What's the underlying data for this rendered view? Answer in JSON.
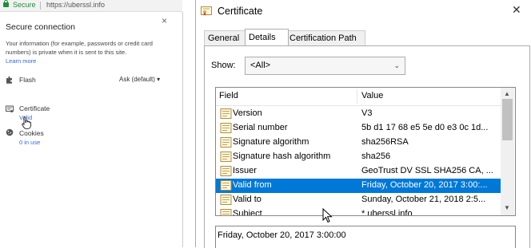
{
  "browser": {
    "secure_label": "Secure",
    "url": "https://uberssl.info"
  },
  "site_info": {
    "title": "Secure connection",
    "description": "Your information (for example, passwords or credit card numbers) is private when it is sent to this site.",
    "learn_more": "Learn more",
    "flash_label": "Flash",
    "flash_setting": "Ask (default)",
    "certificate_label": "Certificate",
    "certificate_status": "Valid",
    "cookies_label": "Cookies",
    "cookies_status": "0 in use",
    "close_glyph": "×",
    "dropdown_glyph": "▾"
  },
  "dialog": {
    "title": "Certificate",
    "close_glyph": "✕",
    "tabs": [
      "General",
      "Details",
      "Certification Path"
    ],
    "active_tab": "Details",
    "show_label": "Show:",
    "show_value": "<All>",
    "show_chevron": "⌄",
    "columns": {
      "field": "Field",
      "value": "Value"
    },
    "rows": [
      {
        "field": "Version",
        "value": "V3"
      },
      {
        "field": "Serial number",
        "value": "5b d1 17 68 e5 5e d0 e3 0c 1d..."
      },
      {
        "field": "Signature algorithm",
        "value": "sha256RSA"
      },
      {
        "field": "Signature hash algorithm",
        "value": "sha256"
      },
      {
        "field": "Issuer",
        "value": "GeoTrust DV SSL SHA256 CA, ..."
      },
      {
        "field": "Valid from",
        "value": "Friday, October 20, 2017 3:00:..."
      },
      {
        "field": "Valid to",
        "value": "Sunday, October 21, 2018 2:5..."
      },
      {
        "field": "Subject",
        "value": "* uberssl.info"
      }
    ],
    "selected_row": "Valid from",
    "scroll_up": "▲",
    "scroll_down": "▼",
    "detail_text": "Friday, October 20, 2017 3:00:00"
  },
  "colors": {
    "secure_green": "#1e8e3e",
    "link_blue": "#3367d6",
    "selection_blue": "#0078d7"
  },
  "icons": {
    "lock": "lock-icon",
    "flash": "puzzle-icon",
    "certificate": "certificate-icon",
    "cookies": "cookie-icon",
    "field": "certificate-field-icon"
  }
}
